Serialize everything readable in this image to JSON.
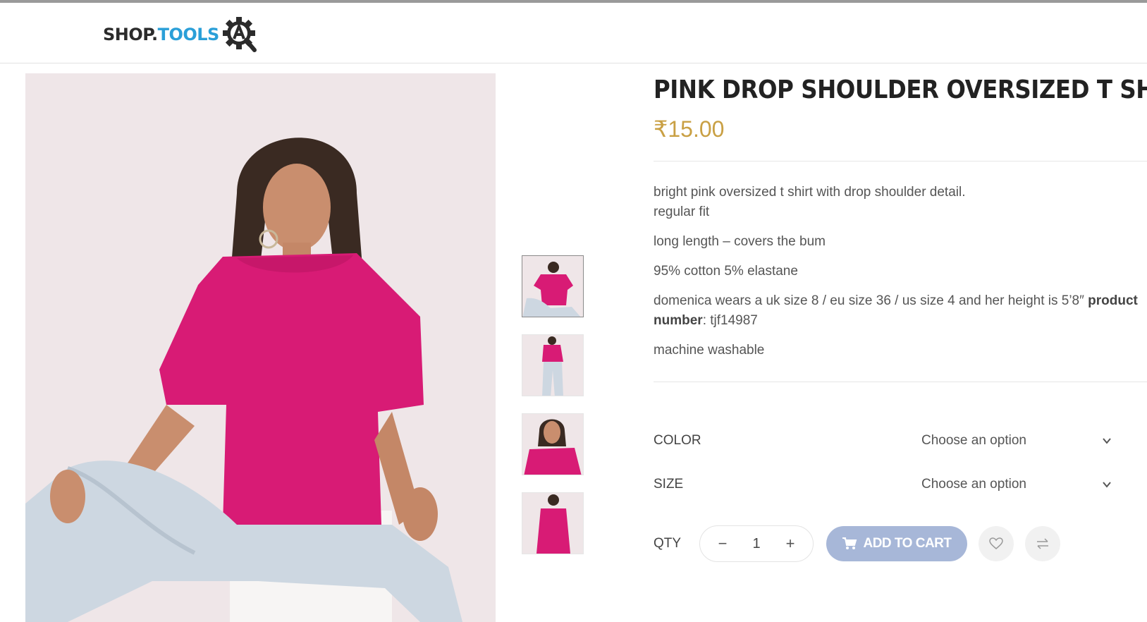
{
  "header": {
    "logo_shop": "SHOP.",
    "logo_tools": "TOOLS",
    "logo_badge": "A"
  },
  "product": {
    "title": "PINK DROP SHOULDER OVERSIZED T SHIRT",
    "price": "₹15.00",
    "description": {
      "line1": "bright pink oversized t shirt with drop shoulder detail.",
      "line2": "regular fit",
      "line3": "long length – covers the bum",
      "line4": "95% cotton 5% elastane",
      "line5_pre": "domenica wears a uk size 8 / eu size 36 / us size 4 and her height is 5’8″",
      "line5_bold": "product number",
      "line5_post": ": tjf14987",
      "line6": "machine washable"
    },
    "thumbnails": [
      "thumb-front-sitting",
      "thumb-full-body",
      "thumb-closeup",
      "thumb-side"
    ]
  },
  "options": {
    "color_label": "COLOR",
    "color_value": "Choose an option",
    "size_label": "SIZE",
    "size_value": "Choose an option"
  },
  "purchase": {
    "qty_label": "QTY",
    "minus": "−",
    "plus": "+",
    "qty_value": "1",
    "add_to_cart": "ADD TO CART"
  },
  "colors": {
    "price": "#c9a044",
    "cart_button": "#a7b7d8",
    "logo_blue": "#2a9fd8",
    "shirt_pink": "#d81b75"
  },
  "icons": [
    "cart-icon",
    "heart-icon",
    "compare-icon",
    "chevron-down-icon",
    "gear-icon"
  ]
}
